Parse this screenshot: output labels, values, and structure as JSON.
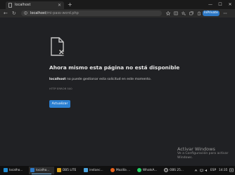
{
  "browser": {
    "tab_title": "localhost",
    "new_tab": "+",
    "window_controls": {
      "minimize": "—",
      "maximize": "☐",
      "close": "✕"
    },
    "tab_close": "✕",
    "address_host": "localhost",
    "address_path": "/mi-pass-word.php",
    "inprivate_label": "InPrivate"
  },
  "nav": {
    "back": "←",
    "reload": "↻"
  },
  "error": {
    "heading": "Ahora mismo esta página no está disponible",
    "host": "localhost",
    "message": "no puede gestionar esta solicitud en este momento.",
    "code": "HTTP ERROR 500",
    "reload_label": "Actualizar"
  },
  "watermark": {
    "title": "Activar Windows",
    "line1": "Ve a Configuración para activar",
    "line2": "Windows."
  },
  "taskbar": {
    "items": [
      {
        "label": "localho...",
        "color": "#1f8ad1"
      },
      {
        "label": "localho...",
        "color": "#2d79c7"
      },
      {
        "label": "DB5 LITE",
        "color": "#d9a11a"
      },
      {
        "label": "instanc...",
        "color": "#4aa3df"
      },
      {
        "label": "Mozilla ...",
        "color": "#e8611c"
      },
      {
        "label": "WhatsA...",
        "color": "#25d366"
      },
      {
        "label": "OBS 25...",
        "color": "#444444"
      }
    ],
    "lang": "ESP",
    "time": "14:35"
  }
}
